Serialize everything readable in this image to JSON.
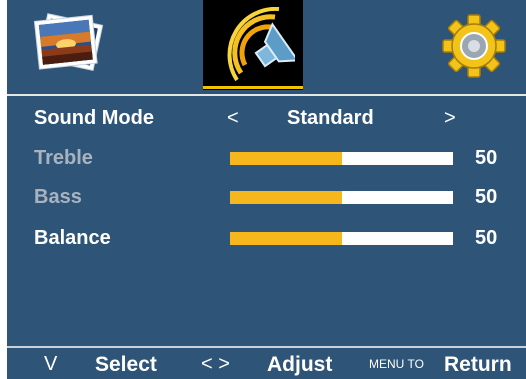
{
  "tabs": [
    {
      "icon": "picture-icon",
      "active": false
    },
    {
      "icon": "sound-icon",
      "active": true
    },
    {
      "icon": "setup-gear-icon",
      "active": false
    }
  ],
  "colors": {
    "background": "#2e5577",
    "accent": "#f5b71c",
    "active_tab": "#000000"
  },
  "menu": {
    "sound_mode": {
      "label": "Sound Mode",
      "value": "Standard",
      "left_arrow": "<",
      "right_arrow": ">"
    },
    "treble": {
      "label": "Treble",
      "value": "50",
      "level": 0.5
    },
    "bass": {
      "label": "Bass",
      "value": "50",
      "level": 0.5
    },
    "balance": {
      "label": "Balance",
      "value": "50",
      "level": 0.5
    }
  },
  "footer": {
    "down_symbol": "V",
    "select_label": "Select",
    "adjust_symbols": "< >",
    "adjust_label": "Adjust",
    "menu_to": "MENU TO",
    "return_label": "Return"
  }
}
